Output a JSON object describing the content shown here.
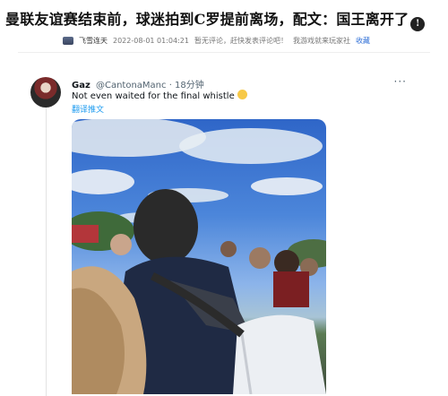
{
  "article": {
    "title": "曼联友谊赛结束前，球迷拍到C罗提前离场，配文：国王离开了",
    "title_emoji": "😱",
    "author": "飞雪连天",
    "datetime": "2022-08-01 01:04:21",
    "comment_status": "暂无评论，赶快发表评论吧！",
    "tagline": "我游戏就来玩家社",
    "follow_label": "收藏"
  },
  "tweet": {
    "name": "Gaz",
    "handle": "@CantonaManc",
    "time": "· 18分钟",
    "text": "Not even waited for the final whistle",
    "translate_label": "翻译推文",
    "more_icon": "more-dots-icon"
  }
}
